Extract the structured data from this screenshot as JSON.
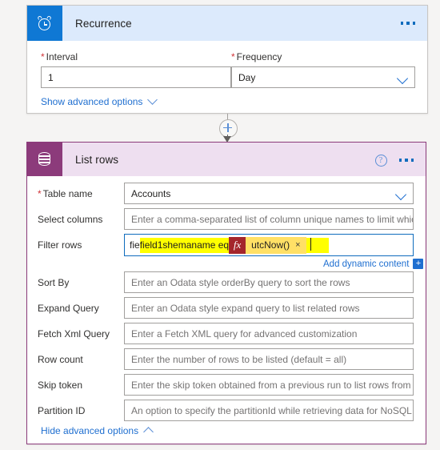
{
  "recurrence": {
    "title": "Recurrence",
    "icon": "alarm-clock-icon",
    "more_label": "...",
    "fields": {
      "interval": {
        "label": "Interval",
        "required": true,
        "value": "1"
      },
      "frequency": {
        "label": "Frequency",
        "required": true,
        "value": "Day"
      }
    },
    "advanced_toggle": "Show advanced options"
  },
  "connector": {
    "add_step_label": "+"
  },
  "list_rows": {
    "title": "List rows",
    "icon": "database-icon",
    "help_label": "?",
    "more_label": "...",
    "fields": [
      {
        "label": "Table name",
        "required": true,
        "value": "Accounts",
        "placeholder": "",
        "type": "dropdown"
      },
      {
        "label": "Select columns",
        "required": false,
        "value": "",
        "placeholder": "Enter a comma-separated list of column unique names to limit which columns",
        "type": "text"
      },
      {
        "label": "Filter rows",
        "required": false,
        "value": "",
        "placeholder": "",
        "type": "expression"
      },
      {
        "label": "Sort By",
        "required": false,
        "value": "",
        "placeholder": "Enter an Odata style orderBy query to sort the rows",
        "type": "text"
      },
      {
        "label": "Expand Query",
        "required": false,
        "value": "",
        "placeholder": "Enter an Odata style expand query to list related rows",
        "type": "text"
      },
      {
        "label": "Fetch Xml Query",
        "required": false,
        "value": "",
        "placeholder": "Enter a Fetch XML query for advanced customization",
        "type": "text"
      },
      {
        "label": "Row count",
        "required": false,
        "value": "",
        "placeholder": "Enter the number of rows to be listed (default = all)",
        "type": "text"
      },
      {
        "label": "Skip token",
        "required": false,
        "value": "",
        "placeholder": "Enter the skip token obtained from a previous run to list rows from the next pa",
        "type": "text"
      },
      {
        "label": "Partition ID",
        "required": false,
        "value": "",
        "placeholder": "An option to specify the partitionId while retrieving data for NoSQL tables",
        "type": "text"
      }
    ],
    "filter_expression": {
      "text_before": "field1shemaname eq",
      "fx_label": "fx",
      "token_label": "utcNow()",
      "token_remove": "×"
    },
    "add_dynamic_content": "Add dynamic content",
    "add_dynamic_plus": "+",
    "advanced_toggle": "Hide advanced options"
  },
  "colors": {
    "recurrence_accent": "#0f78d4",
    "recurrence_header_bg": "#dceafc",
    "listrows_accent": "#8c3b7b",
    "listrows_header_bg": "#eedff0",
    "link": "#1f6fd0",
    "required_star": "#d13438",
    "highlight": "#ffff00",
    "fx_token": "#a4262c",
    "expression_chip": "#ffe066",
    "page_background": "#f5f4f3"
  }
}
